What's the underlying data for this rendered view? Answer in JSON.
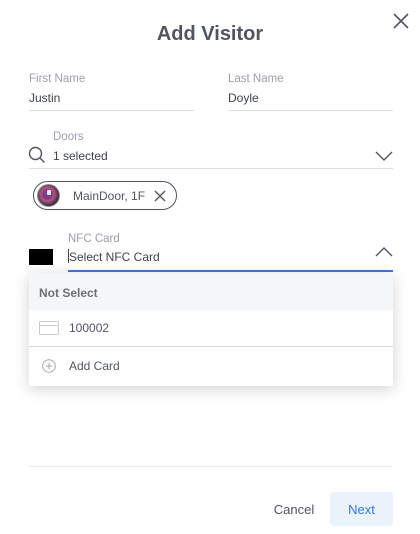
{
  "dialog": {
    "title": "Add Visitor"
  },
  "form": {
    "first_name": {
      "label": "First Name",
      "value": "Justin"
    },
    "last_name": {
      "label": "Last Name",
      "value": "Doyle"
    },
    "doors": {
      "label": "Doors",
      "value": "1 selected"
    },
    "door_chip": {
      "label": "MainDoor, 1F"
    },
    "nfc_card": {
      "label": "NFC Card",
      "placeholder": "Select NFC Card"
    }
  },
  "dropdown": {
    "header": "Not Select",
    "items": [
      {
        "label": "100002",
        "icon": "card-icon"
      },
      {
        "label": "Add Card",
        "icon": "plus-circle-icon"
      }
    ]
  },
  "footer": {
    "cancel_label": "Cancel",
    "next_label": "Next"
  },
  "colors": {
    "accent": "#3a7bd5",
    "primary_button_bg": "#eaf2fc",
    "text": "#50555f"
  }
}
